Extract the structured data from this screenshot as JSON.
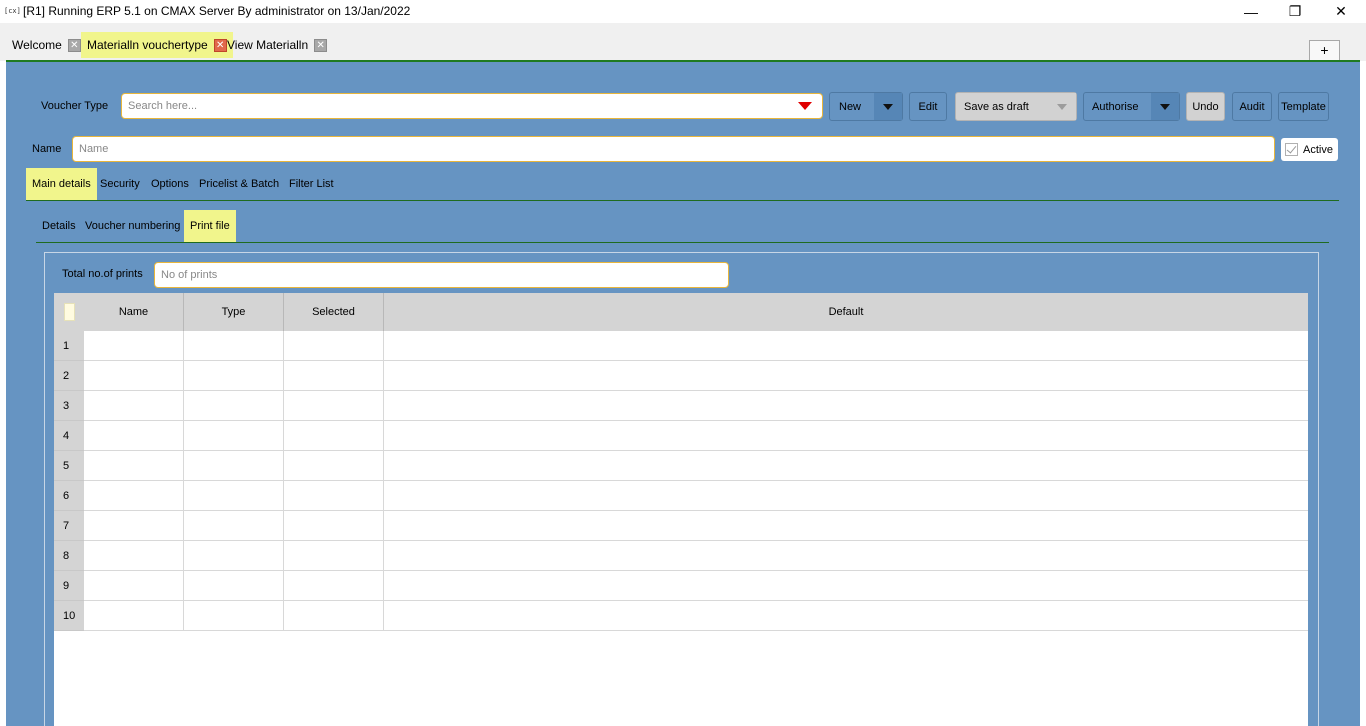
{
  "window": {
    "icon_text": "[cx]",
    "title": "[R1] Running ERP 5.1 on CMAX Server By administrator on 13/Jan/2022",
    "minimize": "—",
    "restore": "❐",
    "close": "✕"
  },
  "tabs": [
    {
      "label": "Welcome",
      "active": false
    },
    {
      "label": "Materialln vouchertype",
      "active": true
    },
    {
      "label": "View Materialln",
      "active": false
    }
  ],
  "tab_close_glyph": "✕",
  "new_tab_button": "+",
  "toolbar": {
    "voucher_type_label": "Voucher Type",
    "search_placeholder": "Search here...",
    "new_label": "New",
    "edit_label": "Edit",
    "save_draft_label": "Save as draft",
    "authorise_label": "Authorise",
    "undo_label": "Undo",
    "audit_label": "Audit",
    "template_label": "Template"
  },
  "name_row": {
    "label": "Name",
    "placeholder": "Name",
    "active_label": "Active"
  },
  "main_tabs": [
    {
      "label": "Main details",
      "active": true
    },
    {
      "label": "Security",
      "active": false
    },
    {
      "label": "Options",
      "active": false
    },
    {
      "label": "Pricelist & Batch",
      "active": false
    },
    {
      "label": "Filter List",
      "active": false
    }
  ],
  "sub_tabs": [
    {
      "label": "Details",
      "active": false
    },
    {
      "label": "Voucher numbering",
      "active": false
    },
    {
      "label": "Print file",
      "active": true
    }
  ],
  "prints": {
    "label": "Total no.of prints",
    "placeholder": "No of prints"
  },
  "grid": {
    "columns": [
      "Name",
      "Type",
      "Selected",
      "Default"
    ],
    "rows": [
      "1",
      "2",
      "3",
      "4",
      "5",
      "6",
      "7",
      "8",
      "9",
      "10"
    ]
  },
  "colors": {
    "panel": "#6694c2",
    "highlight": "#f1f58c",
    "accent_border": "#e8b63c",
    "dropdown_caret": "#e00000"
  }
}
